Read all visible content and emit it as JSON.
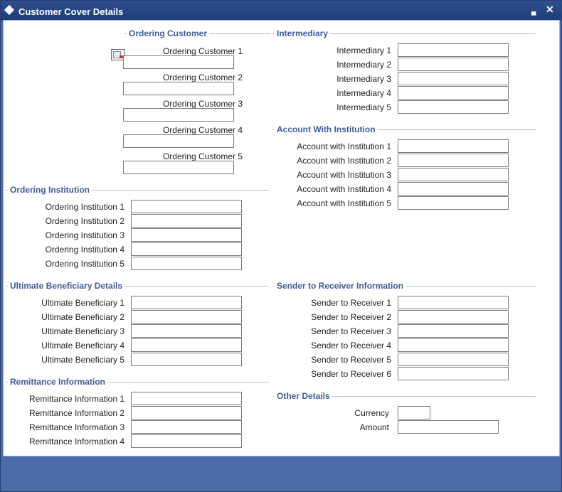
{
  "window": {
    "title": "Customer Cover Details",
    "minimize_label": "▄",
    "close_label": "✕"
  },
  "ordering_customer": {
    "title": "Ordering Customer",
    "fields": [
      "Ordering Customer 1",
      "Ordering Customer 2",
      "Ordering Customer 3",
      "Ordering Customer 4",
      "Ordering Customer 5"
    ],
    "values": [
      "",
      "",
      "",
      "",
      ""
    ]
  },
  "intermediary": {
    "title": "Intermediary",
    "fields": [
      "Intermediary 1",
      "Intermediary 2",
      "Intermediary 3",
      "Intermediary 4",
      "Intermediary 5"
    ],
    "values": [
      "",
      "",
      "",
      "",
      ""
    ]
  },
  "account_with_institution": {
    "title": "Account With Institution",
    "fields": [
      "Account with Institution 1",
      "Account with Institution 2",
      "Account with Institution 3",
      "Account with Institution 4",
      "Account with Institution 5"
    ],
    "values": [
      "",
      "",
      "",
      "",
      ""
    ]
  },
  "ordering_institution": {
    "title": "Ordering Institution",
    "fields": [
      "Ordering Institution 1",
      "Ordering Institution 2",
      "Ordering Institution 3",
      "Ordering Institution 4",
      "Ordering Institution 5"
    ],
    "values": [
      "",
      "",
      "",
      "",
      ""
    ]
  },
  "ultimate_beneficiary": {
    "title": "Ultimate Beneficiary Details",
    "fields": [
      "Ultimate Beneficiary 1",
      "Ultimate Beneficiary 2",
      "Ultimate Beneficiary 3",
      "Ultimate Beneficiary 4",
      "Ultimate Beneficiary 5"
    ],
    "values": [
      "",
      "",
      "",
      "",
      ""
    ]
  },
  "sender_to_receiver": {
    "title": "Sender to Receiver Information",
    "fields": [
      "Sender to Receiver 1",
      "Sender to Receiver 2",
      "Sender to Receiver 3",
      "Sender to Receiver 4",
      "Sender to Receiver 5",
      "Sender to Receiver 6"
    ],
    "values": [
      "",
      "",
      "",
      "",
      "",
      ""
    ]
  },
  "remittance_information": {
    "title": "Remittance Information",
    "fields": [
      "Remittance Information 1",
      "Remittance Information 2",
      "Remittance Information 3",
      "Remittance Information 4"
    ],
    "values": [
      "",
      "",
      "",
      ""
    ]
  },
  "other_details": {
    "title": "Other Details",
    "currency_label": "Currency",
    "currency_value": "",
    "amount_label": "Amount",
    "amount_value": ""
  },
  "colors": {
    "titlebar": "#1e3d78",
    "section_title": "#3d5c99",
    "frame": "#4b69a8"
  }
}
